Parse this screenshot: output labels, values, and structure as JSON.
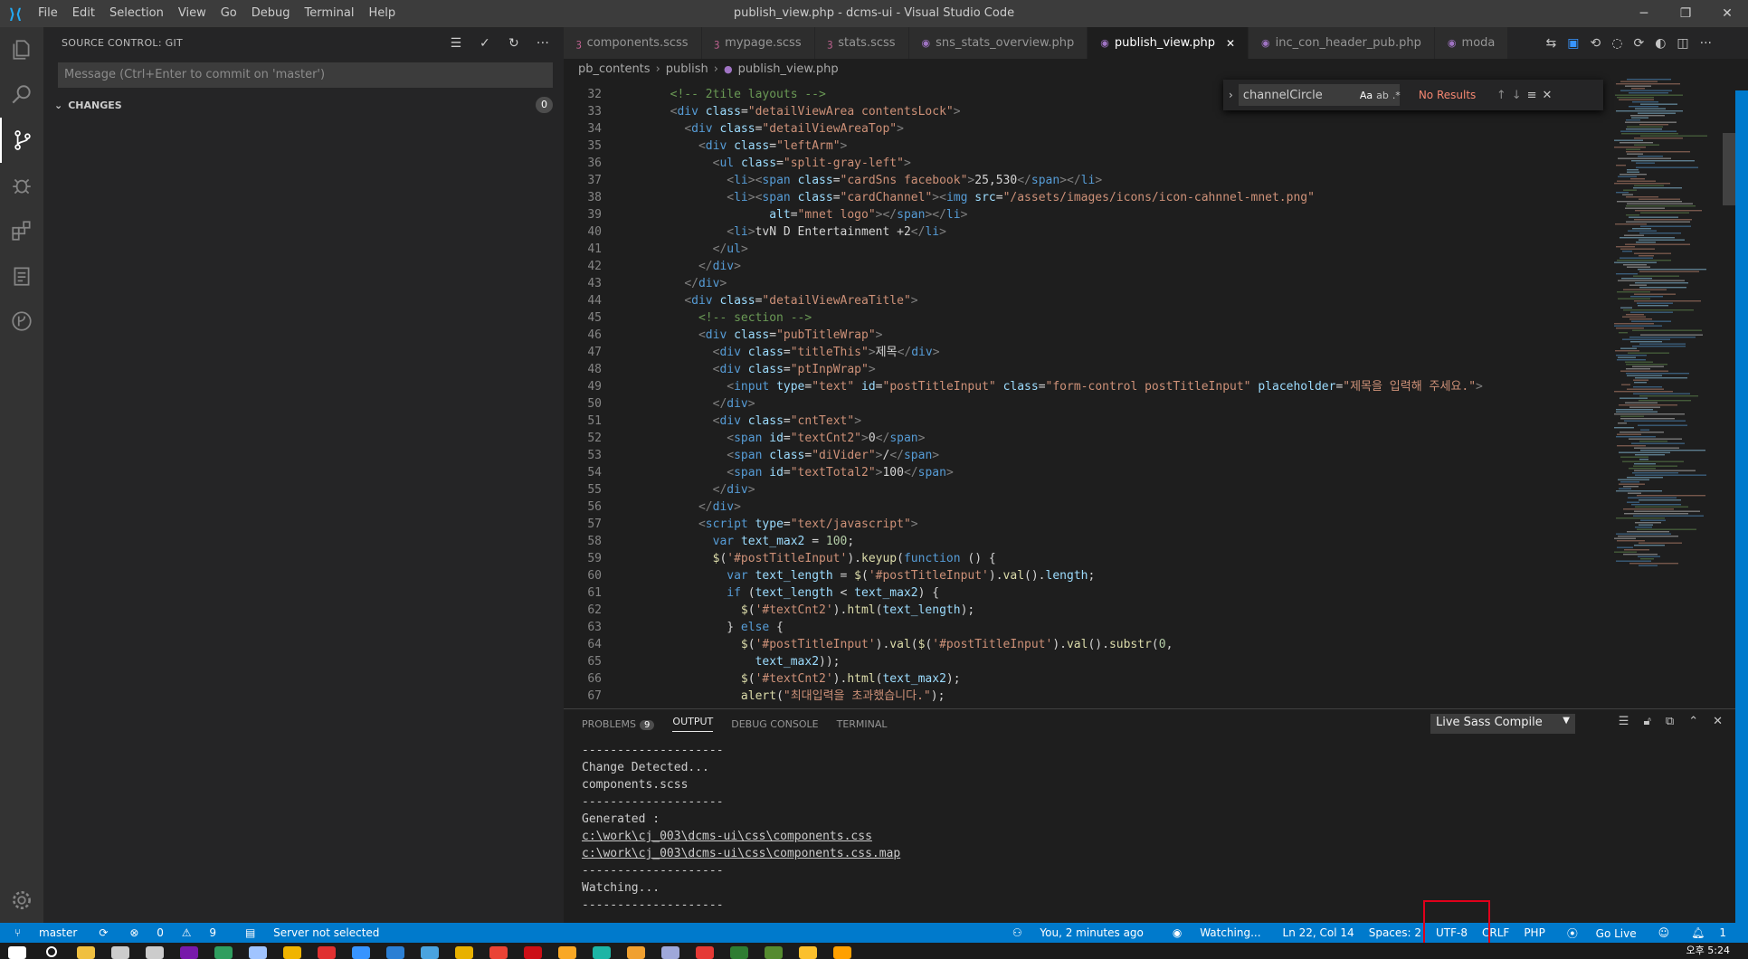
{
  "window": {
    "title": "publish_view.php - dcms-ui - Visual Studio Code",
    "menu": [
      "File",
      "Edit",
      "Selection",
      "View",
      "Go",
      "Debug",
      "Terminal",
      "Help"
    ]
  },
  "sidebar": {
    "header": "SOURCE CONTROL: GIT",
    "commit_placeholder": "Message (Ctrl+Enter to commit on 'master')",
    "changes_label": "CHANGES",
    "changes_count": "0"
  },
  "tabs": [
    {
      "label": "components.scss",
      "type": "scss"
    },
    {
      "label": "mypage.scss",
      "type": "scss"
    },
    {
      "label": "stats.scss",
      "type": "scss"
    },
    {
      "label": "sns_stats_overview.php",
      "type": "php"
    },
    {
      "label": "publish_view.php",
      "type": "php",
      "active": true
    },
    {
      "label": "inc_con_header_pub.php",
      "type": "php"
    },
    {
      "label": "moda",
      "type": "php"
    }
  ],
  "breadcrumb": [
    "pb_contents",
    "publish",
    "publish_view.php"
  ],
  "find": {
    "value": "channelCircle",
    "result": "No Results"
  },
  "editor": {
    "lines": [
      {
        "n": "32",
        "html": "<span class='c'>  &lt;!-- 2tile layouts --&gt;</span>"
      },
      {
        "n": "33",
        "html": "  <span class='p'>&lt;</span><span class='t'>div</span> <span class='a'>class</span>=<span class='s'>\"detailViewArea contentsLock\"</span><span class='p'>&gt;</span>"
      },
      {
        "n": "34",
        "html": "    <span class='p'>&lt;</span><span class='t'>div</span> <span class='a'>class</span>=<span class='s'>\"detailViewAreaTop\"</span><span class='p'>&gt;</span>"
      },
      {
        "n": "35",
        "html": "      <span class='p'>&lt;</span><span class='t'>div</span> <span class='a'>class</span>=<span class='s'>\"leftArm\"</span><span class='p'>&gt;</span>"
      },
      {
        "n": "36",
        "html": "        <span class='p'>&lt;</span><span class='t'>ul</span> <span class='a'>class</span>=<span class='s'>\"split-gray-left\"</span><span class='p'>&gt;</span>"
      },
      {
        "n": "37",
        "html": "          <span class='p'>&lt;</span><span class='t'>li</span><span class='p'>&gt;&lt;</span><span class='t'>span</span> <span class='a'>class</span>=<span class='s'>\"cardSns facebook\"</span><span class='p'>&gt;</span>25,530<span class='p'>&lt;/</span><span class='t'>span</span><span class='p'>&gt;&lt;/</span><span class='t'>li</span><span class='p'>&gt;</span>"
      },
      {
        "n": "38",
        "html": "          <span class='p'>&lt;</span><span class='t'>li</span><span class='p'>&gt;&lt;</span><span class='t'>span</span> <span class='a'>class</span>=<span class='s'>\"cardChannel\"</span><span class='p'>&gt;&lt;</span><span class='t'>img</span> <span class='a'>src</span>=<span class='s'>\"/assets/images/icons/icon-cahnnel-mnet.png\"</span>"
      },
      {
        "n": "39",
        "html": "                <span class='a'>alt</span>=<span class='s'>\"mnet logo\"</span><span class='p'>&gt;&lt;/</span><span class='t'>span</span><span class='p'>&gt;&lt;/</span><span class='t'>li</span><span class='p'>&gt;</span>"
      },
      {
        "n": "40",
        "html": "          <span class='p'>&lt;</span><span class='t'>li</span><span class='p'>&gt;</span>tvN D Entertainment +2<span class='p'>&lt;/</span><span class='t'>li</span><span class='p'>&gt;</span>"
      },
      {
        "n": "41",
        "html": "        <span class='p'>&lt;/</span><span class='t'>ul</span><span class='p'>&gt;</span>"
      },
      {
        "n": "42",
        "html": "      <span class='p'>&lt;/</span><span class='t'>div</span><span class='p'>&gt;</span>"
      },
      {
        "n": "43",
        "html": "    <span class='p'>&lt;/</span><span class='t'>div</span><span class='p'>&gt;</span>"
      },
      {
        "n": "44",
        "html": "    <span class='p'>&lt;</span><span class='t'>div</span> <span class='a'>class</span>=<span class='s'>\"detailViewAreaTitle\"</span><span class='p'>&gt;</span>"
      },
      {
        "n": "45",
        "html": "<span class='c'>      &lt;!-- section --&gt;</span>"
      },
      {
        "n": "46",
        "html": "      <span class='p'>&lt;</span><span class='t'>div</span> <span class='a'>class</span>=<span class='s'>\"pubTitleWrap\"</span><span class='p'>&gt;</span>"
      },
      {
        "n": "47",
        "html": "        <span class='p'>&lt;</span><span class='t'>div</span> <span class='a'>class</span>=<span class='s'>\"titleThis\"</span><span class='p'>&gt;</span>제목<span class='p'>&lt;/</span><span class='t'>div</span><span class='p'>&gt;</span>"
      },
      {
        "n": "48",
        "html": "        <span class='p'>&lt;</span><span class='t'>div</span> <span class='a'>class</span>=<span class='s'>\"ptInpWrap\"</span><span class='p'>&gt;</span>"
      },
      {
        "n": "49",
        "html": "          <span class='p'>&lt;</span><span class='t'>input</span> <span class='a'>type</span>=<span class='s'>\"text\"</span> <span class='a'>id</span>=<span class='s'>\"postTitleInput\"</span> <span class='a'>class</span>=<span class='s'>\"form-control postTitleInput\"</span> <span class='a'>placeholder</span>=<span class='s'>\"제목을 입력해 주세요.\"</span><span class='p'>&gt;</span>"
      },
      {
        "n": "50",
        "html": "        <span class='p'>&lt;/</span><span class='t'>div</span><span class='p'>&gt;</span>"
      },
      {
        "n": "51",
        "html": "        <span class='p'>&lt;</span><span class='t'>div</span> <span class='a'>class</span>=<span class='s'>\"cntText\"</span><span class='p'>&gt;</span>"
      },
      {
        "n": "52",
        "html": "          <span class='p'>&lt;</span><span class='t'>span</span> <span class='a'>id</span>=<span class='s'>\"textCnt2\"</span><span class='p'>&gt;</span>0<span class='p'>&lt;/</span><span class='t'>span</span><span class='p'>&gt;</span>"
      },
      {
        "n": "53",
        "html": "          <span class='p'>&lt;</span><span class='t'>span</span> <span class='a'>class</span>=<span class='s'>\"diVider\"</span><span class='p'>&gt;</span>/<span class='p'>&lt;/</span><span class='t'>span</span><span class='p'>&gt;</span>"
      },
      {
        "n": "54",
        "html": "          <span class='p'>&lt;</span><span class='t'>span</span> <span class='a'>id</span>=<span class='s'>\"textTotal2\"</span><span class='p'>&gt;</span>100<span class='p'>&lt;/</span><span class='t'>span</span><span class='p'>&gt;</span>"
      },
      {
        "n": "55",
        "html": "        <span class='p'>&lt;/</span><span class='t'>div</span><span class='p'>&gt;</span>"
      },
      {
        "n": "56",
        "html": "      <span class='p'>&lt;/</span><span class='t'>div</span><span class='p'>&gt;</span>"
      },
      {
        "n": "57",
        "html": "      <span class='p'>&lt;</span><span class='t'>script</span> <span class='a'>type</span>=<span class='s'>\"text/javascript\"</span><span class='p'>&gt;</span>"
      },
      {
        "n": "58",
        "html": "        <span class='k'>var</span> <span class='a'>text_max2</span> = <span class='n'>100</span>;"
      },
      {
        "n": "59",
        "html": "        <span class='f'>$</span>(<span class='s'>'#postTitleInput'</span>).<span class='f'>keyup</span>(<span class='k'>function</span> () {"
      },
      {
        "n": "60",
        "html": "          <span class='k'>var</span> <span class='a'>text_length</span> = <span class='f'>$</span>(<span class='s'>'#postTitleInput'</span>).<span class='f'>val</span>().<span class='a'>length</span>;"
      },
      {
        "n": "61",
        "html": "          <span class='k'>if</span> (<span class='a'>text_length</span> &lt; <span class='a'>text_max2</span>) {"
      },
      {
        "n": "62",
        "html": "            <span class='f'>$</span>(<span class='s'>'#textCnt2'</span>).<span class='f'>html</span>(<span class='a'>text_length</span>);"
      },
      {
        "n": "63",
        "html": "          } <span class='k'>else</span> {"
      },
      {
        "n": "64",
        "html": "            <span class='f'>$</span>(<span class='s'>'#postTitleInput'</span>).<span class='f'>val</span>(<span class='f'>$</span>(<span class='s'>'#postTitleInput'</span>).<span class='f'>val</span>().<span class='f'>substr</span>(<span class='n'>0</span>,"
      },
      {
        "n": "65",
        "html": "              <span class='a'>text_max2</span>));"
      },
      {
        "n": "66",
        "html": "            <span class='f'>$</span>(<span class='s'>'#textCnt2'</span>).<span class='f'>html</span>(<span class='a'>text_max2</span>);"
      },
      {
        "n": "67",
        "html": "            <span class='f'>alert</span>(<span class='s'>\"최대입력을 초과했습니다.\"</span>);"
      }
    ]
  },
  "panel": {
    "tabs": [
      "PROBLEMS",
      "OUTPUT",
      "DEBUG CONSOLE",
      "TERMINAL"
    ],
    "problems_count": "9",
    "channel": "Live Sass Compile",
    "output_lines": [
      {
        "text": "--------------------",
        "link": false
      },
      {
        "text": "Change Detected...",
        "link": false
      },
      {
        "text": "components.scss",
        "link": false
      },
      {
        "text": "--------------------",
        "link": false
      },
      {
        "text": "Generated :",
        "link": false
      },
      {
        "text": "c:\\work\\cj_003\\dcms-ui\\css\\components.css",
        "link": true
      },
      {
        "text": "c:\\work\\cj_003\\dcms-ui\\css\\components.css.map",
        "link": true
      },
      {
        "text": "--------------------",
        "link": false
      },
      {
        "text": "Watching...",
        "link": false
      },
      {
        "text": "--------------------",
        "link": false
      }
    ]
  },
  "status": {
    "branch": "master",
    "errors": "0",
    "warnings": "9",
    "server": "Server not selected",
    "blame": "You, 2 minutes ago",
    "watching": "Watching...",
    "position": "Ln 22, Col 14",
    "spaces": "Spaces: 2",
    "encoding": "UTF-8",
    "eol": "CRLF",
    "language": "PHP",
    "golive": "Go Live",
    "notifications": "1"
  },
  "taskbar": {
    "clock": "오후 5:24"
  },
  "colors": {
    "accent": "#007acc",
    "highlight": "#e0001b"
  }
}
